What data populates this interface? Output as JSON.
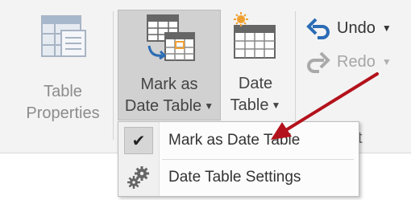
{
  "ribbon": {
    "table_properties": {
      "line1": "Table",
      "line2": "Properties"
    },
    "mark_as_date_table": {
      "line1": "Mark as",
      "line2": "Date Table"
    },
    "date_table": {
      "line1": "Date",
      "line2": "Table"
    },
    "undo_label": "Undo",
    "redo_label": "Redo",
    "group_tail": "t"
  },
  "menu": {
    "items": [
      {
        "label": "Mark as Date Table",
        "icon": "checkmark-icon",
        "checked": true
      },
      {
        "label": "Date Table Settings",
        "icon": "gears-icon"
      }
    ]
  },
  "colors": {
    "ribbon_bg": "#f3f3f3",
    "pressed_bg": "#d1d1d1",
    "undo_blue": "#2b6cb5",
    "annotation_arrow": "#b3121c",
    "calendar_orange": "#f0a030"
  }
}
